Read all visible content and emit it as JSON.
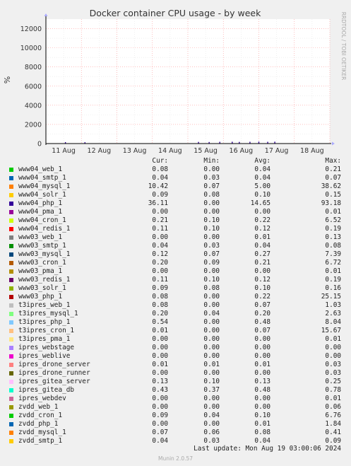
{
  "chart_data": {
    "type": "line",
    "title": "Docker container CPU usage - by week",
    "ylabel": "%",
    "side_label": "RRDTOOL / TOBI OETIKER",
    "ylim": [
      0,
      13000
    ],
    "yticks": [
      0,
      2000,
      4000,
      6000,
      8000,
      10000,
      12000
    ],
    "x_labels": [
      "11 Aug",
      "12 Aug",
      "13 Aug",
      "14 Aug",
      "15 Aug",
      "16 Aug",
      "17 Aug",
      "18 Aug"
    ],
    "grid": true,
    "legend_headers": [
      "Cur:",
      "Min:",
      "Avg:",
      "Max:"
    ],
    "series": [
      {
        "name": "www04_web_1",
        "color": "#00cc00",
        "cur": "0.08",
        "min": "0.00",
        "avg": "0.04",
        "max": "0.21"
      },
      {
        "name": "www04_smtp_1",
        "color": "#0066b3",
        "cur": "0.04",
        "min": "0.03",
        "avg": "0.04",
        "max": "0.07"
      },
      {
        "name": "www04_mysql_1",
        "color": "#ff8000",
        "cur": "10.42",
        "min": "0.07",
        "avg": "5.00",
        "max": "38.62"
      },
      {
        "name": "www04_solr_1",
        "color": "#ffcc00",
        "cur": "0.09",
        "min": "0.08",
        "avg": "0.10",
        "max": "0.15"
      },
      {
        "name": "www04_php_1",
        "color": "#330099",
        "cur": "36.11",
        "min": "0.00",
        "avg": "14.65",
        "max": "93.18"
      },
      {
        "name": "www04_pma_1",
        "color": "#990099",
        "cur": "0.00",
        "min": "0.00",
        "avg": "0.00",
        "max": "0.01"
      },
      {
        "name": "www04_cron_1",
        "color": "#ccff00",
        "cur": "0.21",
        "min": "0.10",
        "avg": "0.22",
        "max": "6.52"
      },
      {
        "name": "www04_redis_1",
        "color": "#ff0000",
        "cur": "0.11",
        "min": "0.10",
        "avg": "0.12",
        "max": "0.19"
      },
      {
        "name": "www03_web_1",
        "color": "#808080",
        "cur": "0.00",
        "min": "0.00",
        "avg": "0.01",
        "max": "0.13"
      },
      {
        "name": "www03_smtp_1",
        "color": "#008f00",
        "cur": "0.04",
        "min": "0.03",
        "avg": "0.04",
        "max": "0.08"
      },
      {
        "name": "www03_mysql_1",
        "color": "#00487d",
        "cur": "0.12",
        "min": "0.07",
        "avg": "0.27",
        "max": "7.39"
      },
      {
        "name": "www03_cron_1",
        "color": "#b35a00",
        "cur": "0.20",
        "min": "0.09",
        "avg": "0.21",
        "max": "6.72"
      },
      {
        "name": "www03_pma_1",
        "color": "#b38f00",
        "cur": "0.00",
        "min": "0.00",
        "avg": "0.00",
        "max": "0.01"
      },
      {
        "name": "www03_redis_1",
        "color": "#6b006b",
        "cur": "0.11",
        "min": "0.10",
        "avg": "0.12",
        "max": "0.19"
      },
      {
        "name": "www03_solr_1",
        "color": "#8fb300",
        "cur": "0.09",
        "min": "0.08",
        "avg": "0.10",
        "max": "0.16"
      },
      {
        "name": "www03_php_1",
        "color": "#b30000",
        "cur": "0.08",
        "min": "0.00",
        "avg": "0.22",
        "max": "25.15"
      },
      {
        "name": "t3ipres_web_1",
        "color": "#bebebe",
        "cur": "0.08",
        "min": "0.00",
        "avg": "0.07",
        "max": "1.03"
      },
      {
        "name": "t3ipres_mysql_1",
        "color": "#80ff80",
        "cur": "0.20",
        "min": "0.04",
        "avg": "0.20",
        "max": "2.63"
      },
      {
        "name": "t3ipres_php_1",
        "color": "#80c9ff",
        "cur": "0.54",
        "min": "0.00",
        "avg": "0.48",
        "max": "8.04"
      },
      {
        "name": "t3ipres_cron_1",
        "color": "#ffc080",
        "cur": "0.01",
        "min": "0.00",
        "avg": "0.07",
        "max": "15.67"
      },
      {
        "name": "t3ipres_pma_1",
        "color": "#ffe680",
        "cur": "0.00",
        "min": "0.00",
        "avg": "0.00",
        "max": "0.01"
      },
      {
        "name": "ipres_webstage",
        "color": "#aa80ff",
        "cur": "0.00",
        "min": "0.00",
        "avg": "0.00",
        "max": "0.00"
      },
      {
        "name": "ipres_weblive",
        "color": "#ee00cc",
        "cur": "0.00",
        "min": "0.00",
        "avg": "0.00",
        "max": "0.00"
      },
      {
        "name": "ipres_drone_server",
        "color": "#ff8080",
        "cur": "0.01",
        "min": "0.01",
        "avg": "0.01",
        "max": "0.03"
      },
      {
        "name": "ipres_drone_runner",
        "color": "#666600",
        "cur": "0.00",
        "min": "0.00",
        "avg": "0.00",
        "max": "0.03"
      },
      {
        "name": "ipres_gitea_server",
        "color": "#ffbfff",
        "cur": "0.13",
        "min": "0.10",
        "avg": "0.13",
        "max": "0.25"
      },
      {
        "name": "ipres_gitea_db",
        "color": "#00ffcc",
        "cur": "0.43",
        "min": "0.37",
        "avg": "0.48",
        "max": "0.78"
      },
      {
        "name": "ipres_webdev",
        "color": "#cc6699",
        "cur": "0.00",
        "min": "0.00",
        "avg": "0.00",
        "max": "0.01"
      },
      {
        "name": "zvdd_web_1",
        "color": "#999900",
        "cur": "0.00",
        "min": "0.00",
        "avg": "0.00",
        "max": "0.06"
      },
      {
        "name": "zvdd_cron_1",
        "color": "#00cc00",
        "cur": "0.09",
        "min": "0.04",
        "avg": "0.10",
        "max": "6.76"
      },
      {
        "name": "zvdd_php_1",
        "color": "#0066b3",
        "cur": "0.00",
        "min": "0.00",
        "avg": "0.01",
        "max": "1.84"
      },
      {
        "name": "zvdd_mysql_1",
        "color": "#ff8000",
        "cur": "0.07",
        "min": "0.06",
        "avg": "0.08",
        "max": "0.41"
      },
      {
        "name": "zvdd_smtp_1",
        "color": "#ffcc00",
        "cur": "0.04",
        "min": "0.03",
        "avg": "0.04",
        "max": "0.09"
      }
    ],
    "spikes": [
      {
        "day": 0.55,
        "value": 40,
        "series": "www04_php_1"
      },
      {
        "day": 1.1,
        "value": 30,
        "series": "www04_php_1"
      },
      {
        "day": 4.3,
        "value": 60,
        "series": "www04_php_1"
      },
      {
        "day": 4.6,
        "value": 50,
        "series": "www04_php_1"
      },
      {
        "day": 4.9,
        "value": 70,
        "series": "www04_php_1"
      },
      {
        "day": 5.25,
        "value": 80,
        "series": "www04_php_1"
      },
      {
        "day": 5.45,
        "value": 60,
        "series": "www04_php_1"
      },
      {
        "day": 5.75,
        "value": 75,
        "series": "www04_php_1"
      },
      {
        "day": 6.0,
        "value": 90,
        "series": "www04_php_1"
      },
      {
        "day": 6.25,
        "value": 70,
        "series": "www04_php_1"
      },
      {
        "day": 6.45,
        "value": 85,
        "series": "www04_php_1"
      },
      {
        "day": 9.3,
        "value": 60,
        "series": "www04_php_1"
      },
      {
        "day": 9.8,
        "value": 50,
        "series": "www04_php_1"
      },
      {
        "day": 10.1,
        "value": 80,
        "series": "www04_php_1"
      },
      {
        "day": 10.4,
        "value": 90,
        "series": "www04_php_1"
      },
      {
        "day": 10.7,
        "value": 70,
        "series": "www04_php_1"
      }
    ]
  },
  "footer": {
    "last_update": "Last update: Mon Aug 19 03:00:06 2024",
    "munin_version": "Munin 2.0.57"
  }
}
